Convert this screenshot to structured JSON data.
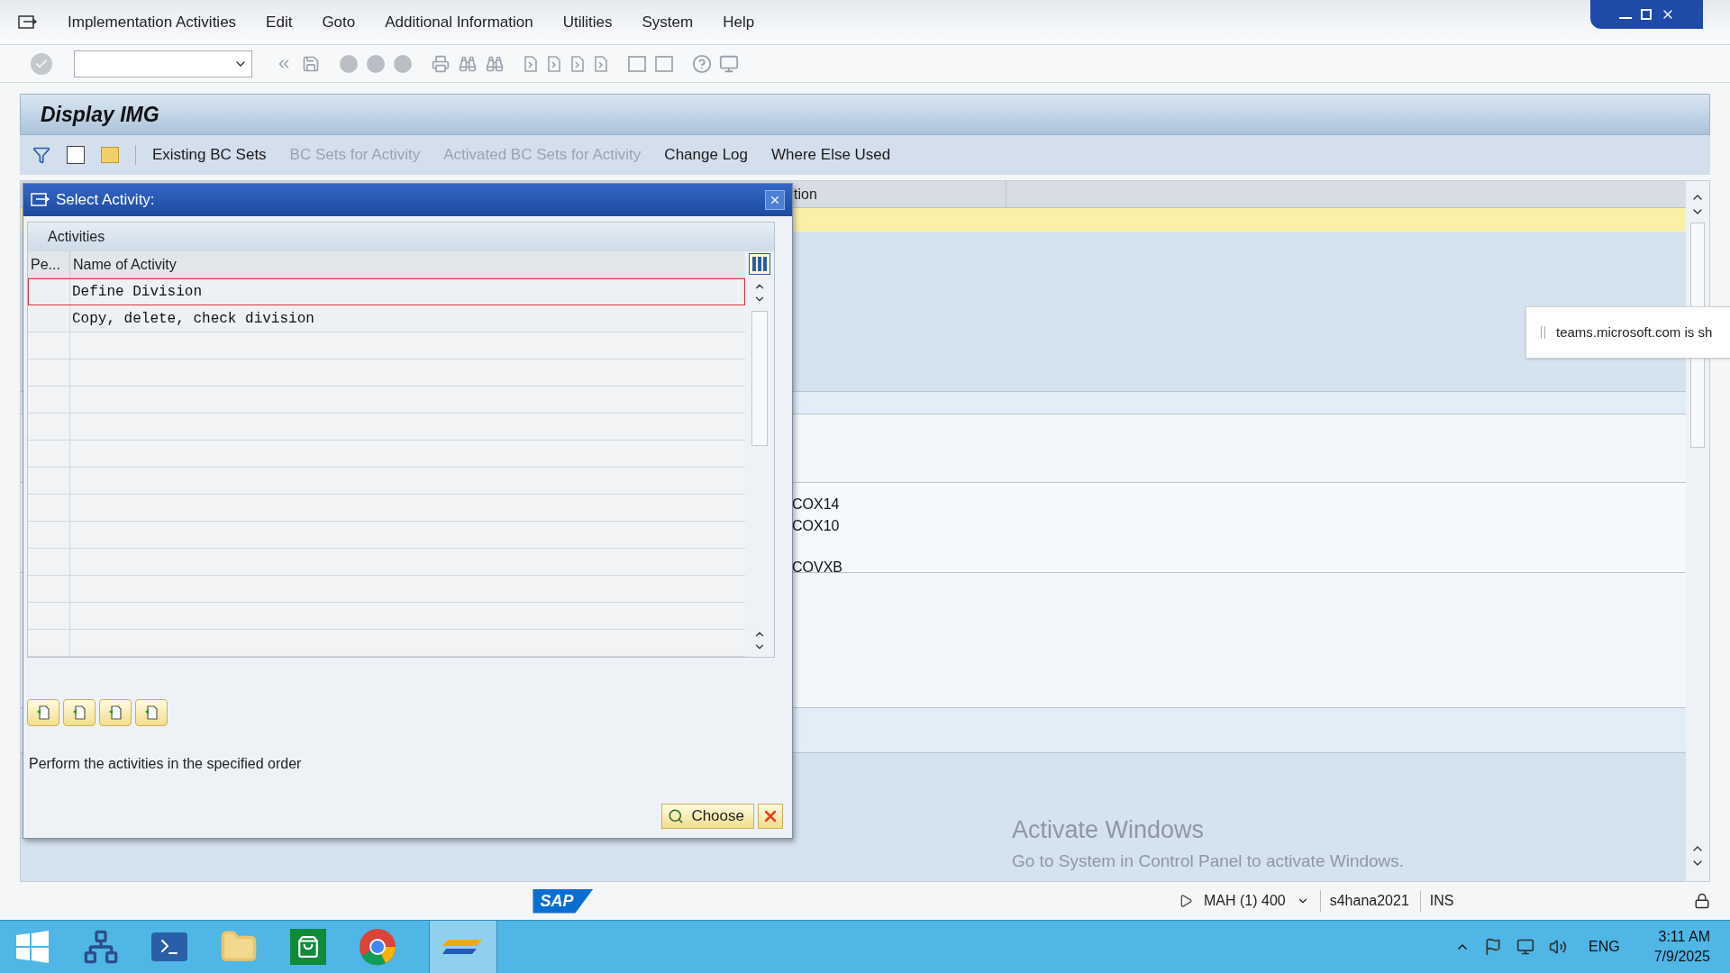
{
  "menu_bar": {
    "items": [
      "Implementation Activities",
      "Edit",
      "Goto",
      "Additional Information",
      "Utilities",
      "System",
      "Help"
    ]
  },
  "screen_title": "Display IMG",
  "app_toolbar": {
    "buttons": [
      {
        "label": "Existing BC Sets",
        "disabled": false
      },
      {
        "label": "BC Sets for Activity",
        "disabled": true
      },
      {
        "label": "Activated BC Sets for Activity",
        "disabled": true
      },
      {
        "label": "Change Log",
        "disabled": false
      },
      {
        "label": "Where Else Used",
        "disabled": false
      }
    ]
  },
  "background_table": {
    "column_1": "tion",
    "rows": [
      "COX14",
      "COX10",
      "COVXB"
    ]
  },
  "dialog": {
    "title": "Select Activity:",
    "section": "Activities",
    "columns": [
      "Pe...",
      "Name of Activity"
    ],
    "rows": [
      {
        "name": "Define Division",
        "selected": true
      },
      {
        "name": "Copy, delete, check division",
        "selected": false
      }
    ],
    "hint": "Perform the activities in the specified order",
    "choose_button": "Choose"
  },
  "notification": {
    "text": "teams.microsoft.com is sh"
  },
  "activation_notice": {
    "title": "Activate Windows",
    "text": "Go to System in Control Panel to activate Windows."
  },
  "status_bar": {
    "logo": "SAP",
    "session": "MAH (1) 400",
    "server": "s4hana2021",
    "mode": "INS"
  },
  "taskbar": {
    "language": "ENG",
    "time": "3:11 AM",
    "date": "7/9/2025"
  }
}
